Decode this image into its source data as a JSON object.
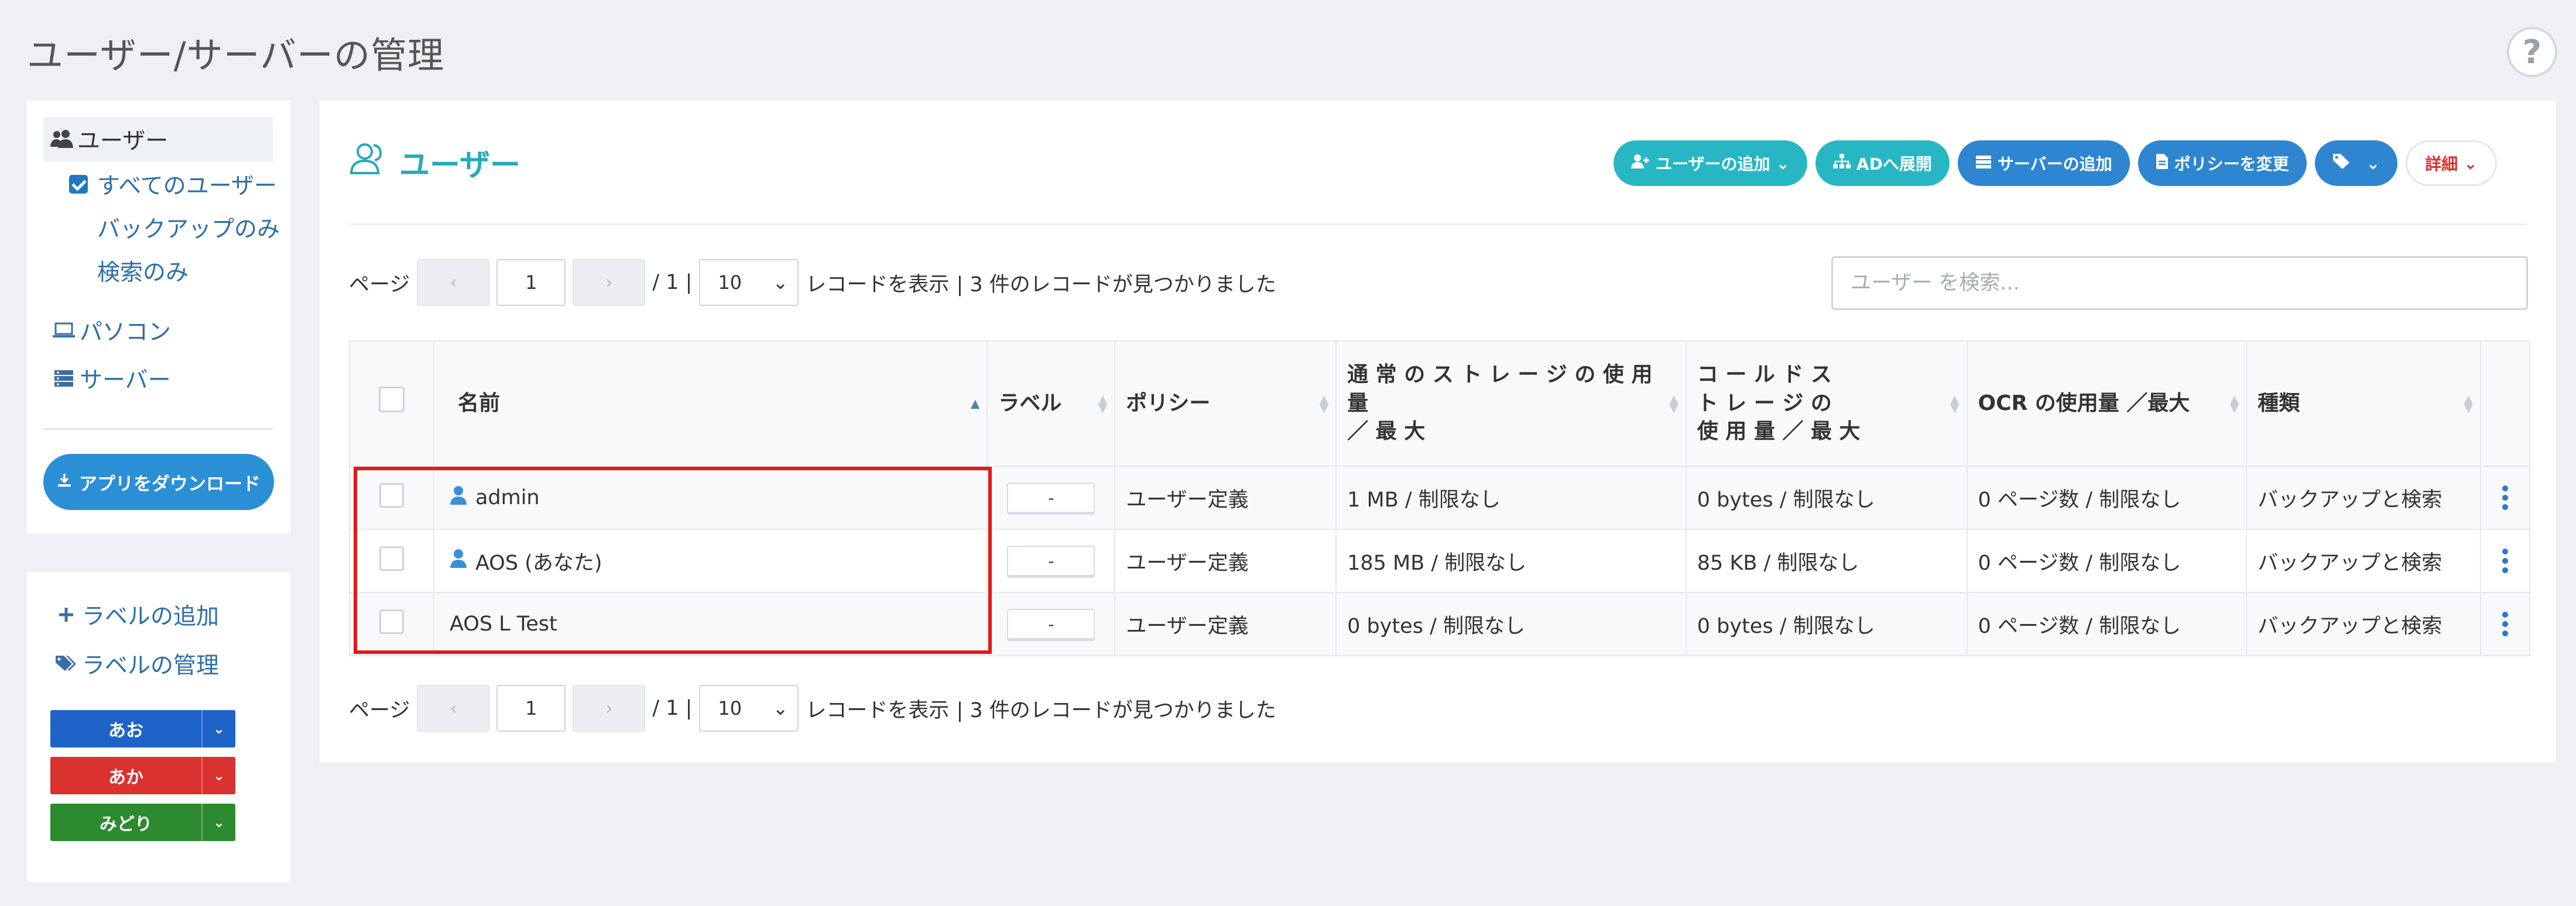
{
  "page": {
    "title": "ユーザー/サーバーの管理",
    "help_icon_text": "?"
  },
  "sidebar": {
    "nav": {
      "users": "ユーザー",
      "all_users": "すべてのユーザー",
      "backup_only": "バックアップのみ",
      "search_only": "検索のみ",
      "pc": "パソコン",
      "server": "サーバー"
    },
    "download_button": "アプリをダウンロード",
    "labels": {
      "add": "ラベルの追加",
      "manage": "ラベルの管理",
      "items": [
        {
          "name": "あお",
          "color": "#1e63c7"
        },
        {
          "name": "あか",
          "color": "#d9322f"
        },
        {
          "name": "みどり",
          "color": "#2d8a2f"
        }
      ]
    }
  },
  "main": {
    "title": "ユーザー",
    "toolbar": {
      "add_user": "ユーザーの追加",
      "ad_deploy": "ADへ展開",
      "add_server": "サーバーの追加",
      "change_policy": "ポリシーを変更",
      "details": "詳細"
    },
    "pager": {
      "page_label": "ページ",
      "prev": "‹",
      "next": "›",
      "current_page": "1",
      "total_pages": "/ 1 |",
      "per_page": "10",
      "show_records": "レコードを表示",
      "found": "| 3 件のレコードが見つかりました"
    },
    "search_placeholder": "ユーザー を検索...",
    "table": {
      "headers": {
        "name": "名前",
        "label": "ラベル",
        "policy": "ポリシー",
        "storage_line1": "通 常 の ス ト レ ー ジ の 使 用 量",
        "storage_line2": "／ 最 大",
        "cold_line1": "コ ー ル ド ス",
        "cold_line2": "ト レ ー ジ の",
        "cold_line3": "使 用 量 ／ 最 大",
        "ocr": "OCR の使用量 ／最大",
        "type": "種類"
      },
      "rows": [
        {
          "name": "admin",
          "has_icon": true,
          "label": "-",
          "policy": "ユーザー定義",
          "storage": "1 MB / 制限なし",
          "cold": "0 bytes / 制限なし",
          "ocr": "0 ページ数 / 制限なし",
          "type": "バックアップと検索"
        },
        {
          "name": "AOS (あなた)",
          "has_icon": true,
          "label": "-",
          "policy": "ユーザー定義",
          "storage": "185 MB / 制限なし",
          "cold": "85 KB / 制限なし",
          "ocr": "0 ページ数 / 制限なし",
          "type": "バックアップと検索"
        },
        {
          "name": "AOS L Test",
          "has_icon": false,
          "label": "-",
          "policy": "ユーザー定義",
          "storage": "0 bytes / 制限なし",
          "cold": "0 bytes / 制限なし",
          "ocr": "0 ページ数 / 制限なし",
          "type": "バックアップと検索"
        }
      ]
    }
  },
  "colors": {
    "accent_teal": "#27b7c4",
    "accent_blue": "#2d86cf",
    "highlight_red": "#e01919"
  }
}
